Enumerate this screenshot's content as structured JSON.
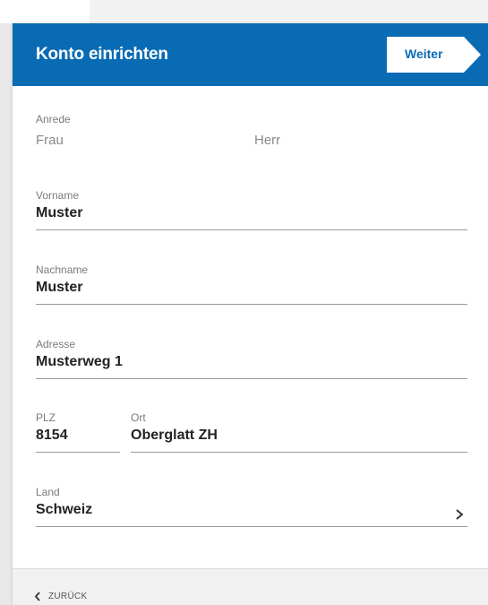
{
  "header": {
    "title": "Konto einrichten",
    "next_label": "Weiter"
  },
  "form": {
    "salutation": {
      "label": "Anrede",
      "options": [
        "Frau",
        "Herr"
      ]
    },
    "first_name": {
      "label": "Vorname",
      "value": "Muster"
    },
    "last_name": {
      "label": "Nachname",
      "value": "Muster"
    },
    "address": {
      "label": "Adresse",
      "value": "Musterweg 1"
    },
    "zip": {
      "label": "PLZ",
      "value": "8154"
    },
    "city": {
      "label": "Ort",
      "value": "Oberglatt ZH"
    },
    "country": {
      "label": "Land",
      "value": "Schweiz"
    }
  },
  "footer": {
    "back_label": "ZURÜCK"
  },
  "colors": {
    "brand": "#0a6bb5",
    "header_text": "#ffffff",
    "footer_bg": "#f1f1f1"
  },
  "icons": [
    "next-arrow-button-shape",
    "chevron-right-icon",
    "chevron-left-icon"
  ]
}
